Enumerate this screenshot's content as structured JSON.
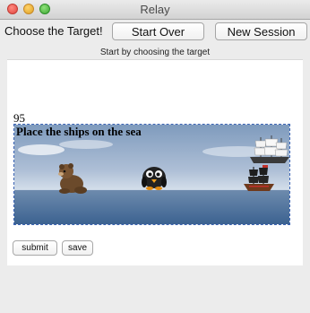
{
  "window": {
    "title": "Relay"
  },
  "toolbar": {
    "target_label": "Choose the Target!",
    "start_over_label": "Start Over",
    "new_session_label": "New Session"
  },
  "status": {
    "text": "Start by choosing the target"
  },
  "game": {
    "score": "95",
    "instruction": "Place the ships on the sea",
    "sprites": [
      "bear-figure",
      "penguin-figure",
      "sailing-ship",
      "pirate-ship"
    ]
  },
  "actions": {
    "submit_label": "submit",
    "save_label": "save"
  }
}
